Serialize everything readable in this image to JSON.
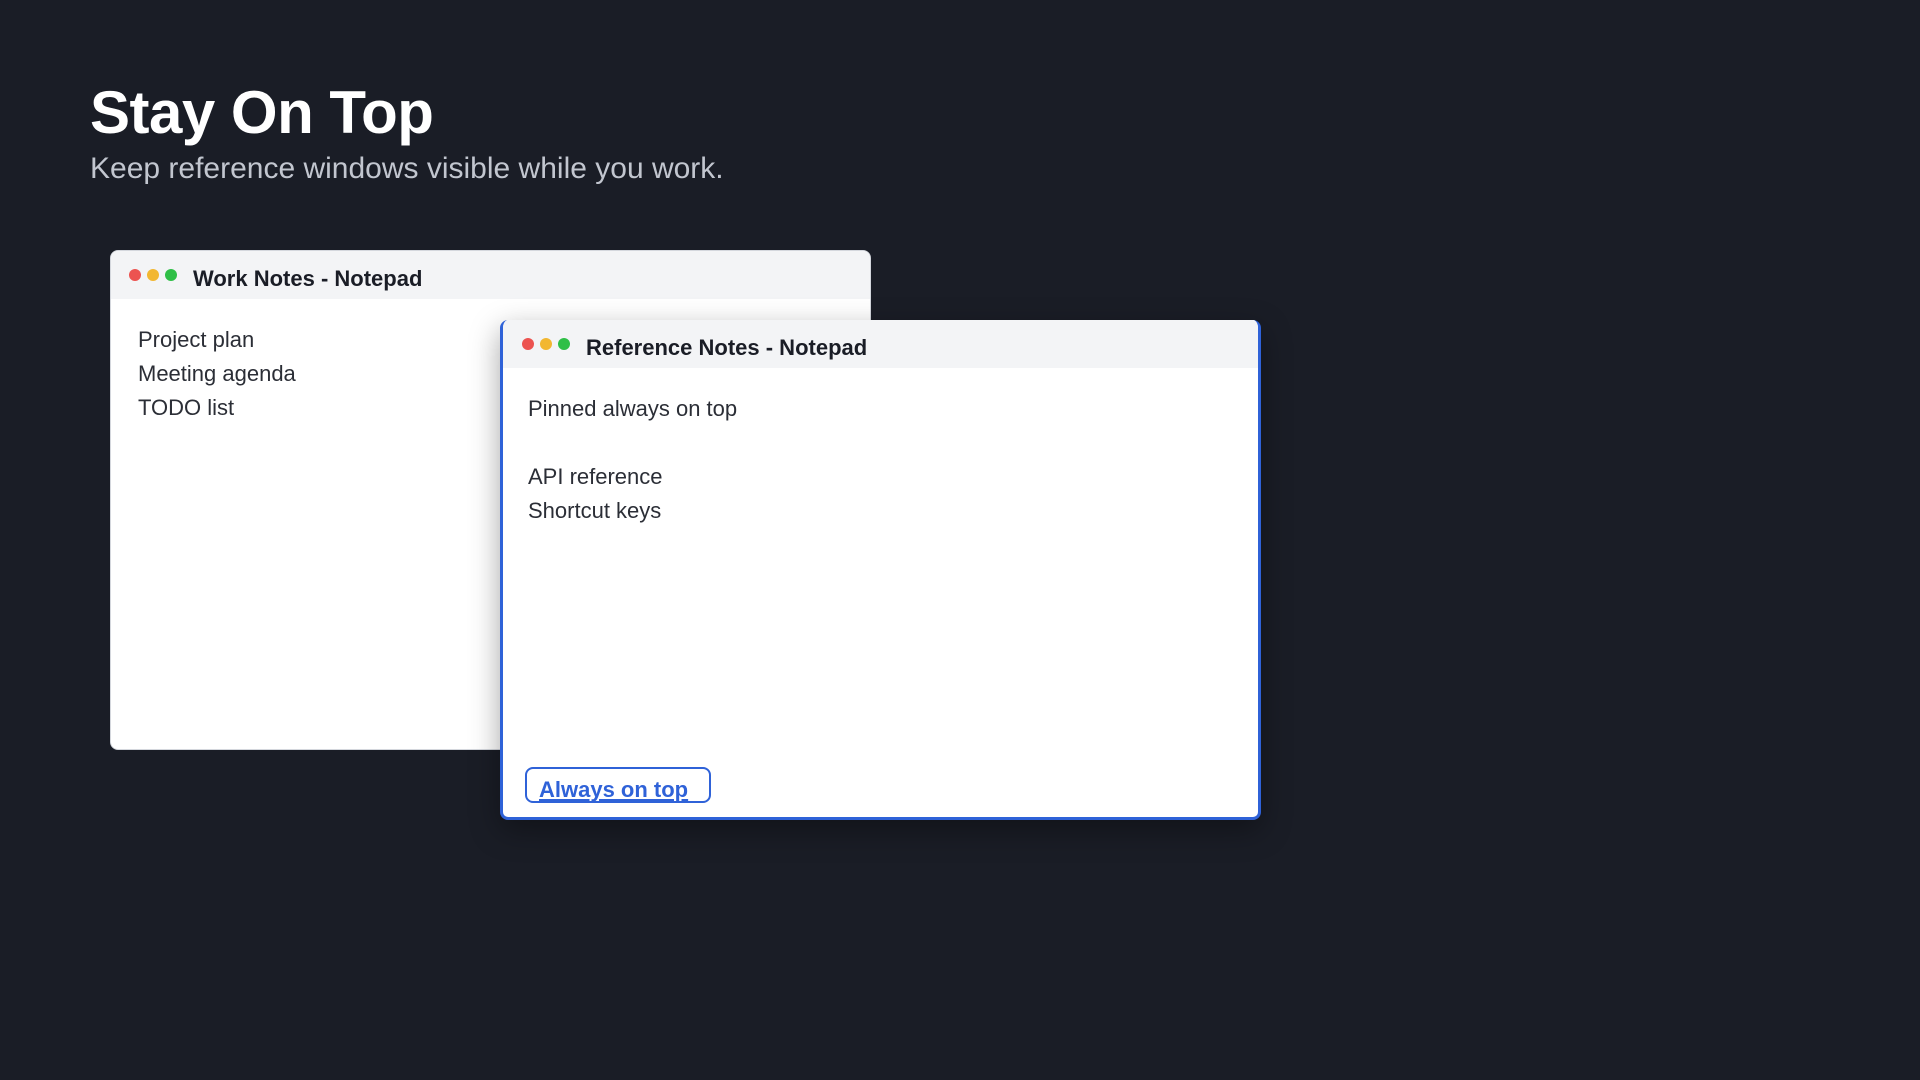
{
  "page": {
    "title": "Stay On Top",
    "subtitle": "Keep reference windows visible while you work."
  },
  "windows": {
    "back": {
      "title": "Work Notes - Notepad",
      "lines": [
        "Project plan",
        "Meeting agenda",
        "TODO list"
      ]
    },
    "front": {
      "title": "Reference Notes - Notepad",
      "lines": [
        "Pinned always on top",
        "",
        "API reference",
        "Shortcut keys"
      ],
      "always_on_top_button": "Always on top",
      "pinned": true
    }
  },
  "colors": {
    "background": "#1a1d26",
    "accent": "#2f62d8",
    "close": "#ec5350",
    "minimize": "#f2b731",
    "maximize": "#2fbf47"
  }
}
